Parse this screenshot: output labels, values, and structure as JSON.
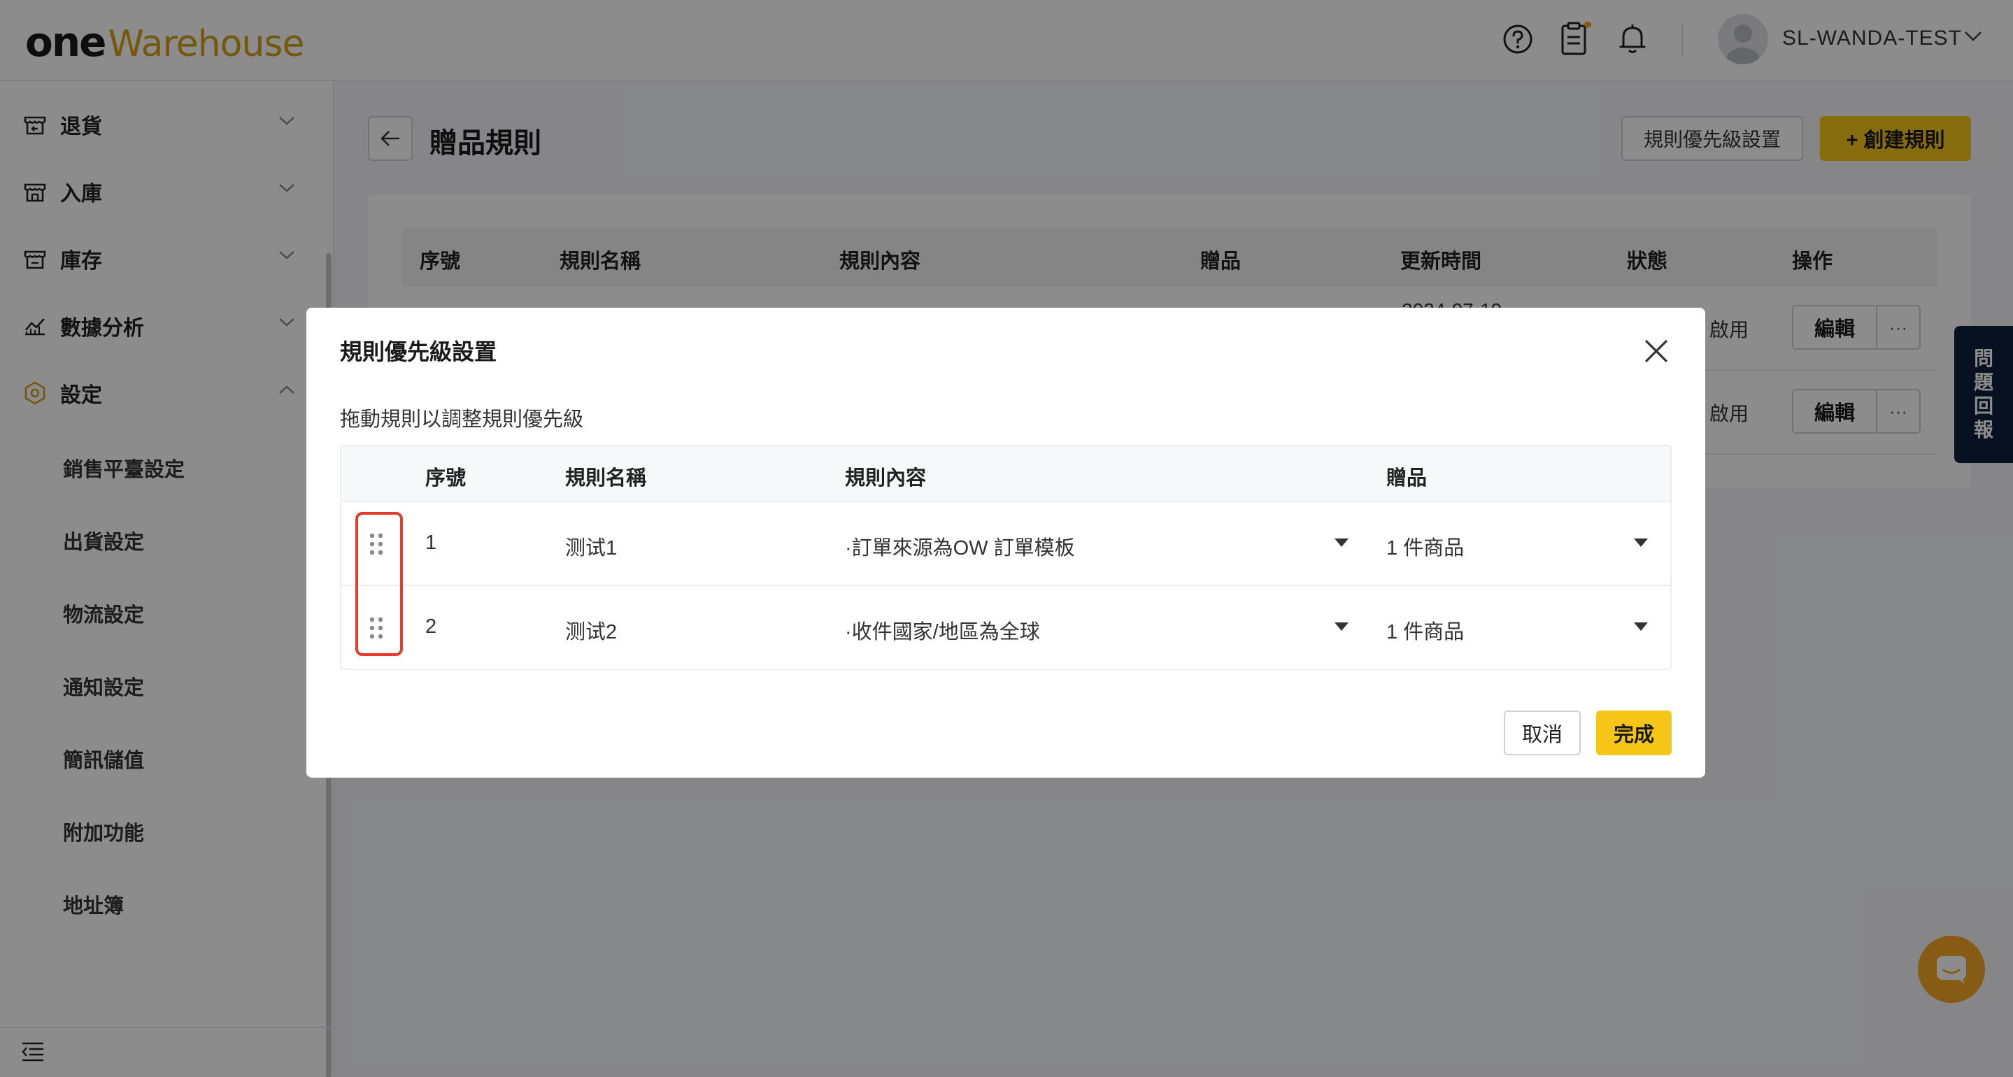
{
  "header": {
    "logo_one": "one",
    "logo_warehouse": "Warehouse",
    "username": "SL-WANDA-TEST",
    "icons": [
      "help-icon",
      "clipboard-icon",
      "bell-icon",
      "chevron-down-icon"
    ],
    "notification_dot_color": "#f5a623"
  },
  "sidebar": {
    "items": [
      {
        "label": "退貨",
        "icon": "return-icon",
        "expanded": false
      },
      {
        "label": "入庫",
        "icon": "inbound-icon",
        "expanded": false
      },
      {
        "label": "庫存",
        "icon": "inventory-icon",
        "expanded": false
      },
      {
        "label": "數據分析",
        "icon": "analytics-icon",
        "expanded": false
      },
      {
        "label": "設定",
        "icon": "settings-icon",
        "expanded": true
      }
    ],
    "sub_items": [
      "銷售平臺設定",
      "出貨設定",
      "物流設定",
      "通知設定",
      "簡訊儲值",
      "附加功能",
      "地址簿"
    ]
  },
  "main": {
    "title": "贈品規則",
    "priority_button": "規則優先級設置",
    "create_button": "+ 創建規則",
    "table": {
      "columns": [
        "序號",
        "規則名稱",
        "規則內容",
        "贈品",
        "更新時間",
        "狀態",
        "操作"
      ],
      "row_timestamp_partial": "2024-07-19",
      "status_partial": "啟用",
      "edit_label": "編輯",
      "more_label": "···"
    }
  },
  "report_tab": {
    "chars": [
      "問",
      "題",
      "回",
      "報"
    ]
  },
  "modal": {
    "title": "規則優先級設置",
    "hint": "拖動規則以調整規則優先級",
    "columns": [
      "序號",
      "規則名稱",
      "規則內容",
      "贈品"
    ],
    "rows": [
      {
        "index": "1",
        "name": "测试1",
        "content": "·訂單來源為OW 訂單模板",
        "gift": "1 件商品"
      },
      {
        "index": "2",
        "name": "测试2",
        "content": "·收件國家/地區為全球",
        "gift": "1 件商品"
      }
    ],
    "cancel_label": "取消",
    "done_label": "完成"
  },
  "colors": {
    "accent_yellow": "#f5c518",
    "brand_gold": "#d4a017",
    "highlight_red": "#e53b2c",
    "report_tab_navy": "#0f1f3d"
  }
}
